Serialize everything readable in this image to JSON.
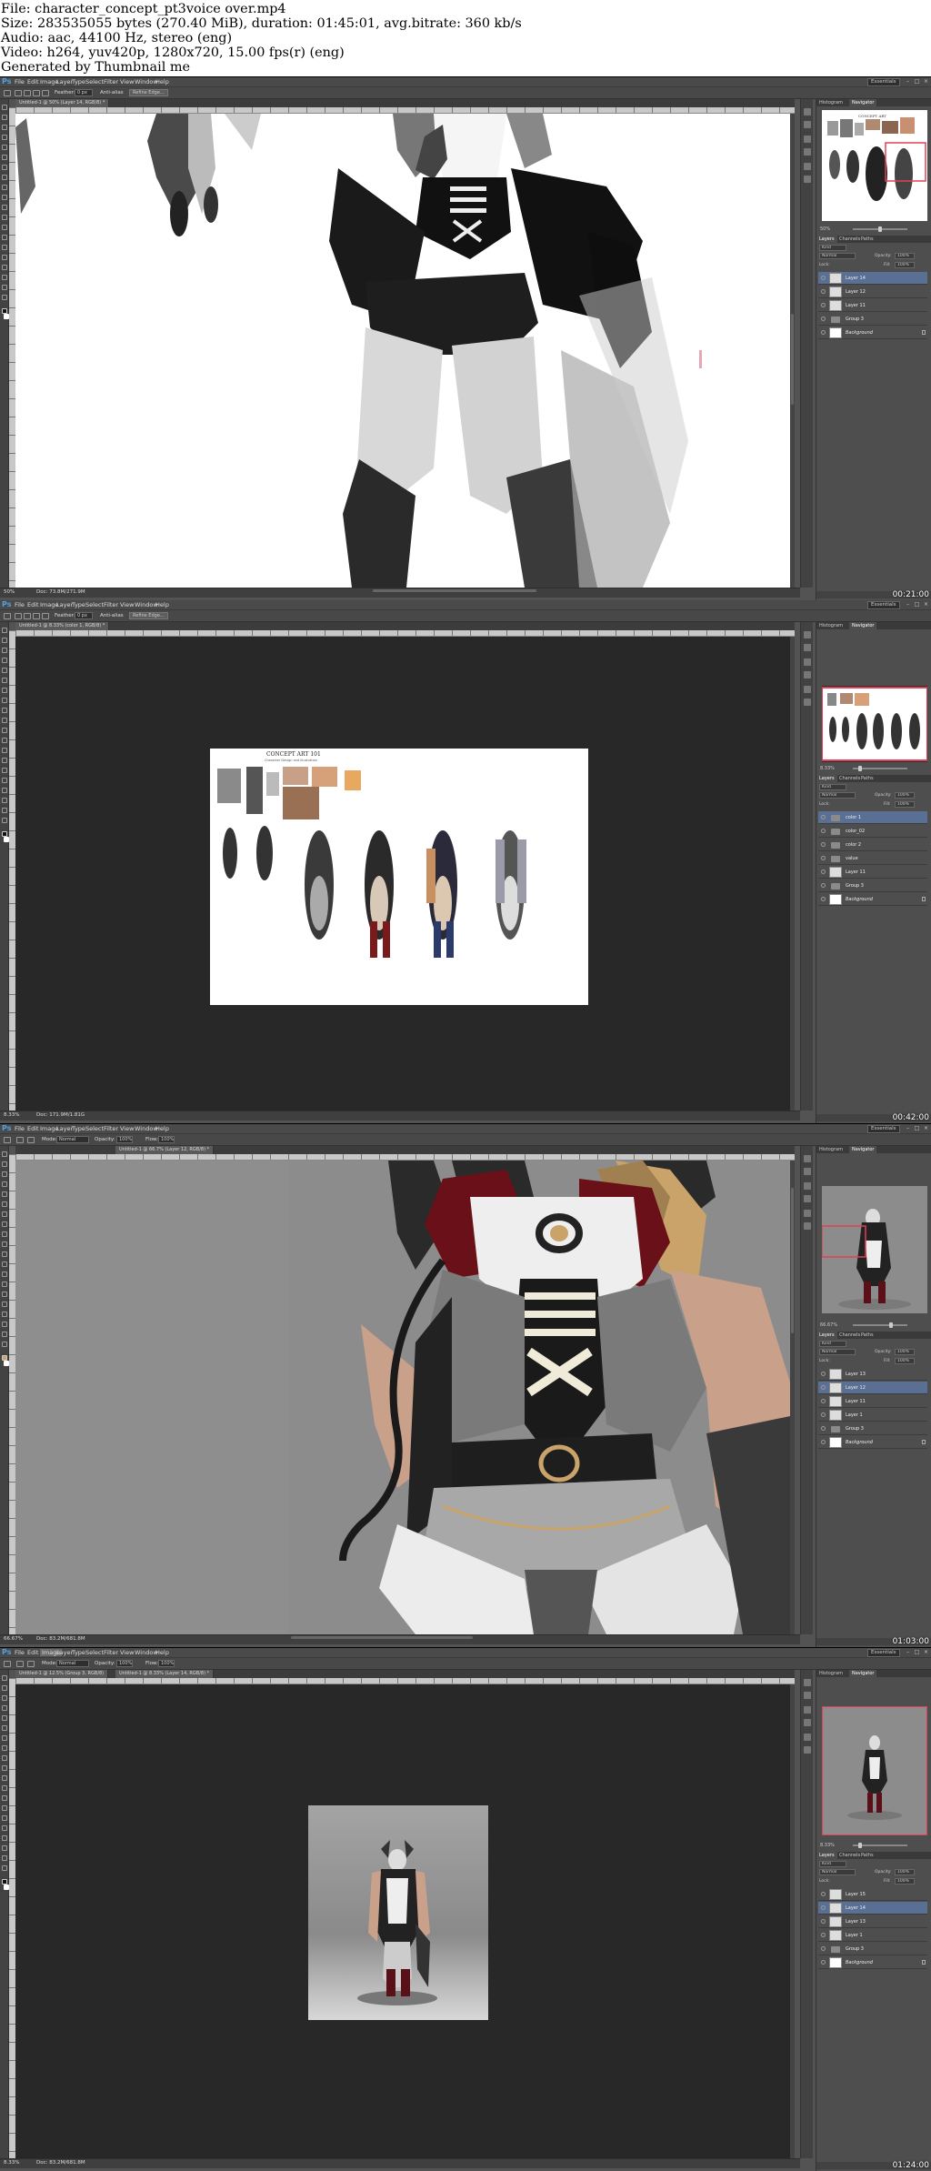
{
  "header": {
    "lines": [
      "File: character_concept_pt3voice over.mp4",
      "Size: 283535055 bytes (270.40 MiB), duration: 01:45:01, avg.bitrate: 360 kb/s",
      "Audio: aac, 44100 Hz, stereo (eng)",
      "Video: h264, yuv420p, 1280x720, 15.00 fps(r) (eng)",
      "Generated by Thumbnail me"
    ]
  },
  "app": {
    "logo": "Ps",
    "menu": [
      "File",
      "Edit",
      "Image",
      "Layer",
      "Type",
      "Select",
      "Filter",
      "View",
      "Window",
      "Help"
    ],
    "workspace": "Essentials",
    "window_controls": [
      "–",
      "□",
      "×"
    ]
  },
  "icons": {
    "app_logo": "photoshop-logo-icon",
    "eye": "visibility-eye-icon",
    "lock": "lock-icon",
    "folder": "folder-icon"
  },
  "colors": {
    "accent_selection": "#5a6f94",
    "nav_box": "#e04055",
    "chrome": "#535353",
    "canvas_dark": "#282828"
  },
  "frames": [
    {
      "timestamp": "00:21:00",
      "tool_options": {
        "feather": "Feather:",
        "feather_val": "0 px",
        "anti_alias": "Anti-alias",
        "refine": "Refine Edge..."
      },
      "doc_tab": "Untitled-1 @ 50% (Layer 14, RGB/8) *",
      "status_zoom": "50%",
      "status_doc": "Doc: 73.8M/271.9M",
      "panel_tabs": [
        "Histogram",
        "Navigator"
      ],
      "nav_zoom": "50%",
      "layers_tabs": [
        "Layers",
        "Channels",
        "Paths"
      ],
      "blend": "Normal",
      "opacity_label": "Opacity:",
      "opacity": "100%",
      "fill_label": "Fill:",
      "fill": "100%",
      "lock_label": "Lock:",
      "kind": "Kind",
      "layers": [
        {
          "name": "Layer 14",
          "selected": true,
          "folder": false,
          "italic": false
        },
        {
          "name": "Layer 12",
          "selected": false,
          "folder": false,
          "italic": false
        },
        {
          "name": "Layer 11",
          "selected": false,
          "folder": false,
          "italic": false
        },
        {
          "name": "Group 3",
          "selected": false,
          "folder": true,
          "italic": false
        },
        {
          "name": "Background",
          "selected": false,
          "folder": false,
          "italic": true
        }
      ]
    },
    {
      "timestamp": "00:42:00",
      "tool_options": {
        "feather": "Feather:",
        "feather_val": "0 px",
        "anti_alias": "Anti-alias",
        "refine": "Refine Edge..."
      },
      "doc_tab": "Untitled-1 @ 8.33% (color 1, RGB/8) *",
      "status_zoom": "8.33%",
      "status_doc": "Doc: 171.9M/1.81G",
      "panel_tabs": [
        "Histogram",
        "Navigator"
      ],
      "nav_zoom": "8.33%",
      "concept_title": "CONCEPT ART 101",
      "concept_sub": "Character Design and Illustration",
      "layers_tabs": [
        "Layers",
        "Channels",
        "Paths"
      ],
      "blend": "Normal",
      "opacity_label": "Opacity:",
      "opacity": "100%",
      "fill_label": "Fill:",
      "fill": "100%",
      "lock_label": "Lock:",
      "kind": "Kind",
      "layers": [
        {
          "name": "color 1",
          "selected": true,
          "folder": true,
          "italic": false
        },
        {
          "name": "color_02",
          "selected": false,
          "folder": true,
          "italic": false
        },
        {
          "name": "color 2",
          "selected": false,
          "folder": true,
          "italic": false
        },
        {
          "name": "value",
          "selected": false,
          "folder": true,
          "italic": false
        },
        {
          "name": "Layer 11",
          "selected": false,
          "folder": false,
          "italic": false
        },
        {
          "name": "Group 3",
          "selected": false,
          "folder": true,
          "italic": false
        },
        {
          "name": "Background",
          "selected": false,
          "folder": false,
          "italic": true
        }
      ]
    },
    {
      "timestamp": "01:03:00",
      "tool_options": {
        "mode_label": "Mode:",
        "mode": "Normal",
        "opacity_label": "Opacity:",
        "opacity": "100%",
        "flow_label": "Flow:",
        "flow": "100%"
      },
      "doc_tab": "Untitled-1 @ 66.7% (Layer 12, RGB/8) *",
      "status_zoom": "66.67%",
      "status_doc": "Doc: 83.2M/681.8M",
      "panel_tabs": [
        "Histogram",
        "Navigator"
      ],
      "nav_zoom": "66.67%",
      "layers_tabs": [
        "Layers",
        "Channels",
        "Paths"
      ],
      "blend": "Normal",
      "opacity_label": "Opacity:",
      "opacity": "100%",
      "fill_label": "Fill:",
      "fill": "100%",
      "lock_label": "Lock:",
      "kind": "Kind",
      "layers": [
        {
          "name": "Layer 13",
          "selected": false,
          "folder": false,
          "italic": false
        },
        {
          "name": "Layer 12",
          "selected": true,
          "folder": false,
          "italic": false
        },
        {
          "name": "Layer 11",
          "selected": false,
          "folder": false,
          "italic": false
        },
        {
          "name": "Layer 1",
          "selected": false,
          "folder": false,
          "italic": false
        },
        {
          "name": "Group 3",
          "selected": false,
          "folder": true,
          "italic": false
        },
        {
          "name": "Background",
          "selected": false,
          "folder": false,
          "italic": true
        }
      ]
    },
    {
      "timestamp": "01:24:00",
      "tool_options": {
        "mode_label": "Mode:",
        "mode": "Normal",
        "opacity_label": "Opacity:",
        "opacity": "100%",
        "flow_label": "Flow:",
        "flow": "100%"
      },
      "doc_tab": "Untitled-1 @ 8.33% (Layer 14, RGB/8) *",
      "doc_tab2": "Untitled-1 @ 12.5% (Group 3, RGB/8)",
      "status_zoom": "8.33%",
      "status_doc": "Doc: 83.2M/681.8M",
      "panel_tabs": [
        "Histogram",
        "Navigator"
      ],
      "nav_zoom": "8.33%",
      "layers_tabs": [
        "Layers",
        "Channels",
        "Paths"
      ],
      "blend": "Normal",
      "opacity_label": "Opacity:",
      "opacity": "100%",
      "fill_label": "Fill:",
      "fill": "100%",
      "lock_label": "Lock:",
      "kind": "Kind",
      "layers": [
        {
          "name": "Layer 15",
          "selected": false,
          "folder": false,
          "italic": false
        },
        {
          "name": "Layer 14",
          "selected": true,
          "folder": false,
          "italic": false
        },
        {
          "name": "Layer 13",
          "selected": false,
          "folder": false,
          "italic": false
        },
        {
          "name": "Layer 1",
          "selected": false,
          "folder": false,
          "italic": false
        },
        {
          "name": "Group 3",
          "selected": false,
          "folder": true,
          "italic": false
        },
        {
          "name": "Background",
          "selected": false,
          "folder": false,
          "italic": true
        }
      ]
    }
  ]
}
